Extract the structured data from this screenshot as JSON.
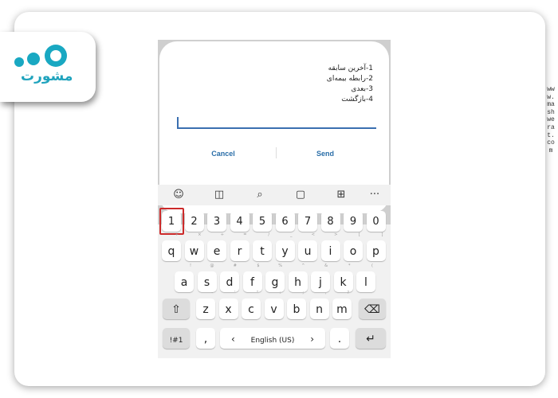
{
  "brand": {
    "logo_text": "مشورت",
    "watermark": "www.mashwerat.com"
  },
  "dialog": {
    "message_lines": [
      "1-آخرین سابقه",
      "2-رابطه بیمه‌ای",
      "3-بعدی",
      "4-بازگشت"
    ],
    "input_value": "",
    "cancel_label": "Cancel",
    "send_label": "Send"
  },
  "keyboard": {
    "toolbar_icons": [
      "emoji-icon",
      "sticker-icon",
      "search-icon",
      "clipboard-icon",
      "translate-icon",
      "more-icon"
    ],
    "toolbar_glyphs": [
      "☺",
      "◫",
      "⌕",
      "▢",
      "⊞",
      "···"
    ],
    "number_row": [
      "1",
      "2",
      "3",
      "4",
      "5",
      "6",
      "7",
      "8",
      "9",
      "0"
    ],
    "row_q": [
      {
        "k": "q",
        "s": "+"
      },
      {
        "k": "w",
        "s": "×"
      },
      {
        "k": "e",
        "s": "÷"
      },
      {
        "k": "r",
        "s": "="
      },
      {
        "k": "t",
        "s": "/"
      },
      {
        "k": "y",
        "s": "_"
      },
      {
        "k": "u",
        "s": "<"
      },
      {
        "k": "i",
        "s": ">"
      },
      {
        "k": "o",
        "s": "["
      },
      {
        "k": "p",
        "s": "]"
      }
    ],
    "row_a": [
      {
        "k": "a",
        "s": "!"
      },
      {
        "k": "s",
        "s": "@"
      },
      {
        "k": "d",
        "s": "#"
      },
      {
        "k": "f",
        "s": "$"
      },
      {
        "k": "g",
        "s": "%"
      },
      {
        "k": "h",
        "s": "^"
      },
      {
        "k": "j",
        "s": "&"
      },
      {
        "k": "k",
        "s": "*"
      },
      {
        "k": "l",
        "s": "("
      }
    ],
    "row_z": [
      {
        "k": "z",
        "s": "-"
      },
      {
        "k": "x",
        "s": "'"
      },
      {
        "k": "c",
        "s": "\""
      },
      {
        "k": "v",
        "s": ":"
      },
      {
        "k": "b",
        "s": ";"
      },
      {
        "k": "n",
        "s": ","
      },
      {
        "k": "m",
        "s": "?"
      }
    ],
    "symbols_label": "!#1",
    "comma_label": ",",
    "period_label": ".",
    "space_label": "English (US)",
    "left_arrow": "‹",
    "right_arrow": "›",
    "shift_glyph": "⇧",
    "backspace_glyph": "⌫",
    "enter_glyph": "↵",
    "highlight_color": "#cc2a2a"
  }
}
